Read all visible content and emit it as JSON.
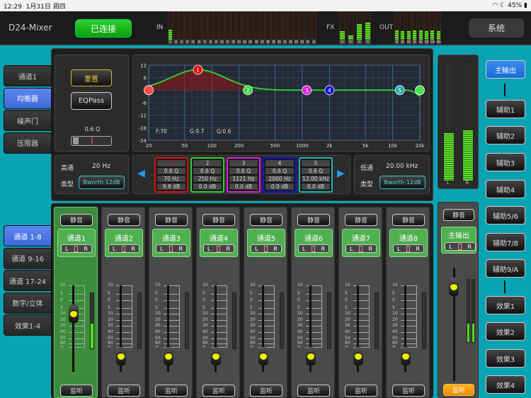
{
  "status": {
    "time": "12:29",
    "date": "1月31日 周四",
    "battery": "45%"
  },
  "header": {
    "title": "D24-Mixer",
    "connection": "已连接",
    "system": "系统",
    "in_label": "IN",
    "fx_label": "FX",
    "out_label": "OUT",
    "in_meters": {
      "labels": [
        "1",
        "2",
        "3",
        "4",
        "5",
        "6",
        "7",
        "8",
        "9",
        "10",
        "11",
        "12",
        "13",
        "14",
        "15",
        "16",
        "17",
        "18",
        "19",
        "20",
        "21",
        "22",
        "23",
        "24",
        "D",
        "S"
      ],
      "levels": [
        0.35,
        0,
        0,
        0,
        0,
        0,
        0,
        0,
        0,
        0,
        0,
        0,
        0,
        0,
        0,
        0,
        0,
        0,
        0,
        0,
        0,
        0,
        0,
        0,
        0,
        0
      ]
    },
    "fx_meters": {
      "labels": [
        "1",
        "2",
        "3",
        "4"
      ],
      "levels": [
        0.3,
        0.15,
        0.55,
        0.6
      ]
    },
    "out_meters": {
      "labels": [
        "M",
        "A1",
        "A2",
        "A3",
        "A4",
        "5/6",
        "7/8",
        "9/A"
      ],
      "levels": [
        0.32,
        0.3,
        0.3,
        0.32,
        0.32,
        0.3,
        0.32,
        0.3
      ]
    }
  },
  "channel_tabs": [
    "通道1",
    "均衡器",
    "噪声门",
    "压限器"
  ],
  "channel_tab_active": 1,
  "eq": {
    "reset": "重置",
    "eqpass": "EQPass",
    "q_label": "0.6 Q",
    "hpf": {
      "label": "高通",
      "value": "20 Hz",
      "type_label": "类型",
      "type": "Bworth-12dB"
    },
    "lpf": {
      "label": "低通",
      "value": "20.00 kHz",
      "type_label": "类型",
      "type": "Bworth-12dB"
    },
    "readout": {
      "f": "F:70",
      "g": "G:9.7",
      "q": "Q:0.6"
    },
    "y_ticks": [
      "12",
      "6",
      "0",
      "-6",
      "-12",
      "-18",
      "-24"
    ],
    "x_ticks": [
      {
        "f": 20,
        "t": "20"
      },
      {
        "f": 50,
        "t": "50"
      },
      {
        "f": 100,
        "t": "100"
      },
      {
        "f": 200,
        "t": "200"
      },
      {
        "f": 500,
        "t": "500"
      },
      {
        "f": 1000,
        "t": "1000"
      },
      {
        "f": 2000,
        "t": "2k"
      },
      {
        "f": 5000,
        "t": "5k"
      },
      {
        "f": 10000,
        "t": "10k"
      },
      {
        "f": 20000,
        "t": "20k"
      }
    ],
    "bands": [
      {
        "n": "1",
        "q": "0.6 Q",
        "freq": "70 Hz",
        "gain": "9.8 dB",
        "hz": 70,
        "db": 9.8,
        "qv": 0.6,
        "color": "#e01010"
      },
      {
        "n": "2",
        "q": "0.6 Q",
        "freq": "250 Hz",
        "gain": "0.0 dB",
        "hz": 250,
        "db": 0,
        "qv": 0.6,
        "color": "#30d030"
      },
      {
        "n": "3",
        "q": "0.6 Q",
        "freq": "1121 Hz",
        "gain": "0.0 dB",
        "hz": 1121,
        "db": 0,
        "qv": 0.6,
        "color": "#e020e0"
      },
      {
        "n": "4",
        "q": "0.6 Q",
        "freq": "2000 Hz",
        "gain": "0.0 dB",
        "hz": 2000,
        "db": 0,
        "qv": 0.6,
        "color": "#1010e0"
      },
      {
        "n": "5",
        "q": "0.6 Q",
        "freq": "12.00 kHz",
        "gain": "0.0 dB",
        "hz": 12000,
        "db": 0,
        "qv": 0.6,
        "color": "#20b0b0"
      }
    ]
  },
  "bank_tabs": [
    "通道 1-8",
    "通道 9-16",
    "通道 17-24",
    "数字/立体",
    "效果1-4"
  ],
  "bank_active": 0,
  "strips": [
    {
      "name": "通道1",
      "mute": "静音",
      "solo": "监听",
      "fader_db": -10,
      "meter": 0.45,
      "selected": true
    },
    {
      "name": "通道2",
      "mute": "静音",
      "solo": "监听",
      "fader_db": -100,
      "meter": 0
    },
    {
      "name": "通道3",
      "mute": "静音",
      "solo": "监听",
      "fader_db": -100,
      "meter": 0
    },
    {
      "name": "通道4",
      "mute": "静音",
      "solo": "监听",
      "fader_db": -100,
      "meter": 0
    },
    {
      "name": "通道5",
      "mute": "静音",
      "solo": "监听",
      "fader_db": -100,
      "meter": 0
    },
    {
      "name": "通道6",
      "mute": "静音",
      "solo": "监听",
      "fader_db": -100,
      "meter": 0
    },
    {
      "name": "通道7",
      "mute": "静音",
      "solo": "监听",
      "fader_db": -100,
      "meter": 0
    },
    {
      "name": "通道8",
      "mute": "静音",
      "solo": "监听",
      "fader_db": -100,
      "meter": 0
    }
  ],
  "pan": {
    "l": "L",
    "r": "R"
  },
  "fader_scale": [
    "10",
    "5",
    "0",
    "5",
    "10",
    "20",
    "30",
    "40",
    "50",
    "90",
    "∞"
  ],
  "master": {
    "name": "主输出",
    "mute": "静音",
    "solo": "监听",
    "meter_l": 0.4,
    "meter_r": 0.42,
    "l": "L",
    "r": "R",
    "fader_db": 0,
    "strip_meter": 0.3
  },
  "bus_buttons": [
    "主输出",
    "辅助1",
    "辅助2",
    "辅助3",
    "辅助4",
    "辅助5/6",
    "辅助7/8",
    "辅助9/A",
    "效果1",
    "效果2",
    "效果3",
    "效果4"
  ],
  "bus_active": 0
}
